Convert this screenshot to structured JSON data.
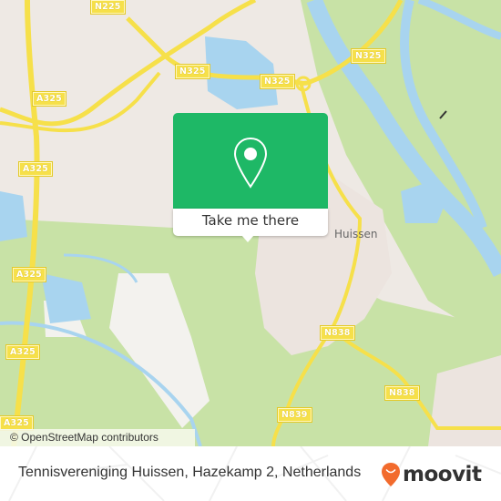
{
  "map": {
    "road_labels": [
      {
        "name": "N225"
      },
      {
        "name": "N325"
      },
      {
        "name": "N325"
      },
      {
        "name": "N325"
      },
      {
        "name": "A325"
      },
      {
        "name": "A325"
      },
      {
        "name": "A325"
      },
      {
        "name": "A325"
      },
      {
        "name": "A325"
      },
      {
        "name": "N838"
      },
      {
        "name": "N838"
      },
      {
        "name": "N839"
      }
    ],
    "place_labels": [
      {
        "name": "Huissen"
      }
    ],
    "colors": {
      "land": "#eee9e4",
      "green": "#c8e2a6",
      "water": "#a8d4ef",
      "road": "#f6e04a"
    },
    "attribution": "© OpenStreetMap contributors"
  },
  "popup": {
    "button_label": "Take me there",
    "icon": "map-pin-icon",
    "color": "#1eb866"
  },
  "footer": {
    "address": "Tennisvereniging Huissen, Hazekamp 2, Netherlands",
    "brand": "moovit",
    "brand_color": "#f26b2d"
  }
}
